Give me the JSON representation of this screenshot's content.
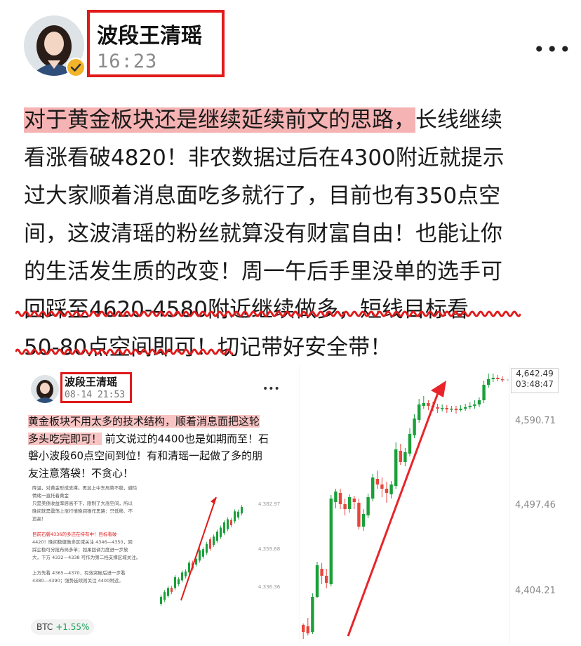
{
  "post": {
    "author": "波段王清瑶",
    "time": "16:23",
    "more": "•••",
    "lines": [
      {
        "hl": "对于黄金板块还是继续延续前文的思路，",
        "rest": "长线继续"
      },
      {
        "text": "看涨看破4820！非农数据过后在4300附近就提示"
      },
      {
        "text": "过大家顺着消息面吃多就行了，目前也有350点空"
      },
      {
        "text": "间，这波清瑶的粉丝就算没有财富自由！也能让你"
      },
      {
        "text": "的生活发生质的改变！周一午后手里没单的选手可"
      },
      {
        "text": "回踩至4620-4580附近继续做多，短线目标看"
      },
      {
        "text": "50-80点空间即可！切记带好安全带！"
      }
    ]
  },
  "embedded": {
    "author": "波段王清瑶",
    "time": "08-14 21:53",
    "more": "•••",
    "lines": [
      {
        "hl": "黄金板块不用太多的技术结构，顺着消息面把这轮",
        "rest": ""
      },
      {
        "hl": "多头吃完即可！",
        "rest": "前文说过的4400也是如期而至！石"
      },
      {
        "text": "磐小波段60点空间到位！有和清瑶一起做了多的朋"
      },
      {
        "text": "友注意落袋！不贪心！"
      }
    ],
    "tiny_lines": [
      {
        "text": "降温，对黄金形成支撑。再加上中东局势不稳，避险",
        "red": false
      },
      {
        "text": "情绪一直托着黄金",
        "red": false
      },
      {
        "text": "只是美债收益率居高不下，限制了大涨空间，所以",
        "red": false
      },
      {
        "text": "晚间就是震荡上涨行情晚间操作思路：只低移、不",
        "red": false
      },
      {
        "text": "追高！",
        "red": false
      },
      {
        "text": "",
        "red": false
      },
      {
        "text": "目前石磐4336的多还在持有中！目标看破",
        "red": true
      },
      {
        "text": "4420！晚间稳健做多区域关注 4346—4350，回",
        "red": false
      },
      {
        "text": "踩企稳可分批布局多单；如果回调力度进一步放",
        "red": false
      },
      {
        "text": "大，下方 4332—4338 可作为第二档支撑区域关注。",
        "red": false
      },
      {
        "text": "",
        "red": false
      },
      {
        "text": "上方先看 4365—4370，有效突破后进一步看",
        "red": false
      },
      {
        "text": "4380—4390；强势延续则关注 4400附近。",
        "red": false
      }
    ],
    "mini_axis": [
      "4,382.97",
      "4,359.68",
      "4,336.36"
    ],
    "ticker": {
      "symbol": "BTC",
      "change": "+1.55%"
    }
  },
  "chart": {
    "price": "4,642.49",
    "countdown": "03:48:47",
    "axis_labels": [
      "4,590.71",
      "4,497.46",
      "4,404.21"
    ],
    "up_color": "#1aa039",
    "down_color": "#e8453c"
  }
}
